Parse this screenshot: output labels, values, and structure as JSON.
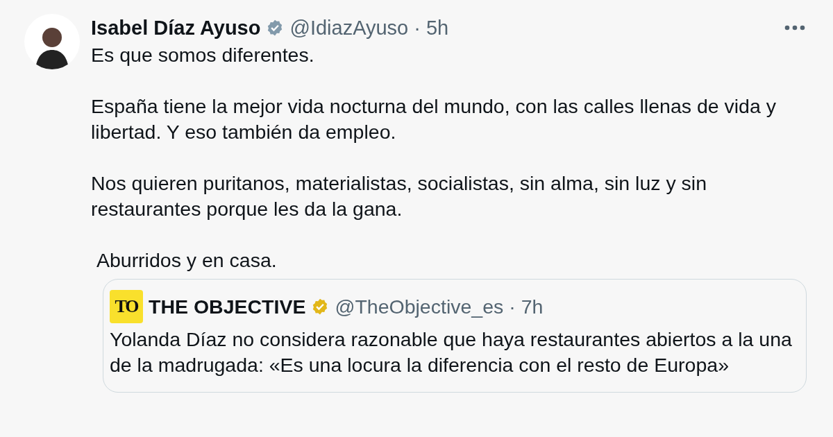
{
  "tweet": {
    "author": {
      "name": "Isabel Díaz Ayuso",
      "verified": true,
      "handle": "@IdiazAyuso",
      "separator": "·",
      "time": "5h"
    },
    "paragraphs": [
      "Es que somos diferentes.",
      "España tiene la mejor vida nocturna del mundo, con las calles llenas de vida y libertad. Y eso también da empleo.",
      "Nos quieren puritanos, materialistas, socialistas, sin alma, sin luz y sin restaurantes porque les da la gana.",
      " Aburridos y en casa."
    ],
    "quote": {
      "logo_text": "TO",
      "name": "THE OBJECTIVE",
      "verified": true,
      "handle": "@TheObjective_es",
      "separator": "·",
      "time": "7h",
      "text": "Yolanda Díaz no considera razonable que haya restaurantes abiertos a la una de la madrugada: «Es una locura la diferencia con el resto de Europa»"
    }
  }
}
